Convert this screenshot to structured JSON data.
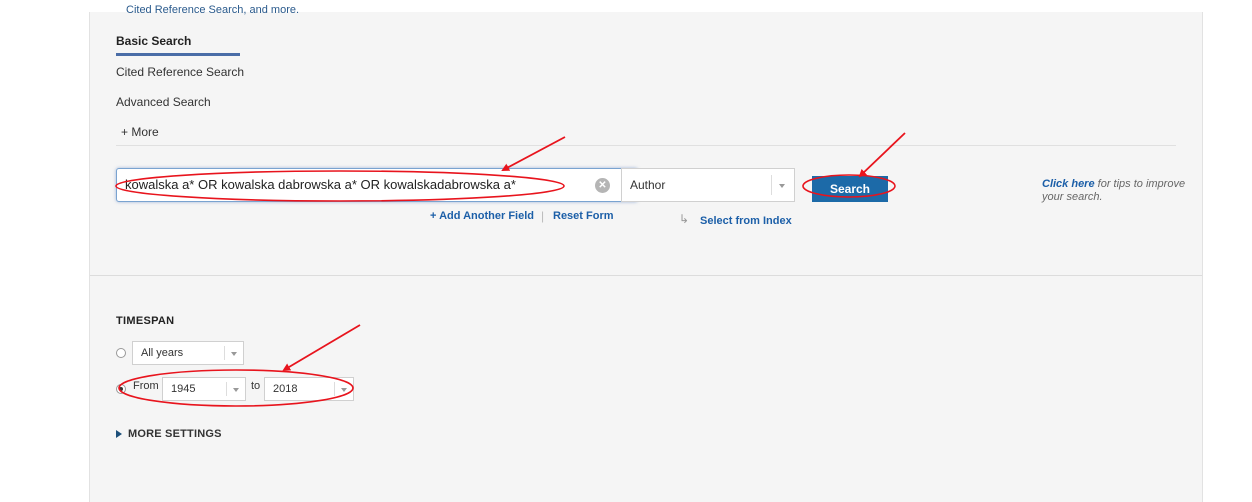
{
  "tabs": {
    "cut_link": "Cited Reference Search, and more.",
    "basic": "Basic Search",
    "cited": "Cited Reference Search",
    "advanced": "Advanced Search",
    "more": "+ More"
  },
  "search": {
    "query_value": "kowalska a* OR kowalska dabrowska a* OR kowalskadabrowska a*",
    "clear_icon": "clear-icon",
    "field_value": "Author",
    "search_label": "Search",
    "add_field": "+ Add Another Field",
    "pipe": "|",
    "reset_form": "Reset Form",
    "select_index": "Select from Index",
    "tips_link": "Click here",
    "tips_text": " for tips to improve your search."
  },
  "timespan": {
    "title": "TIMESPAN",
    "all_years": "All years",
    "from_label": "From",
    "from_value": "1945",
    "to_label": "to",
    "to_value": "2018",
    "all_years_selected": false,
    "range_selected": true
  },
  "more_settings": "MORE SETTINGS",
  "colors": {
    "annotation": "#e8141d",
    "search_button": "#1c6aa8",
    "tab_underline": "#4a6da7",
    "link": "#1c5fa8"
  }
}
